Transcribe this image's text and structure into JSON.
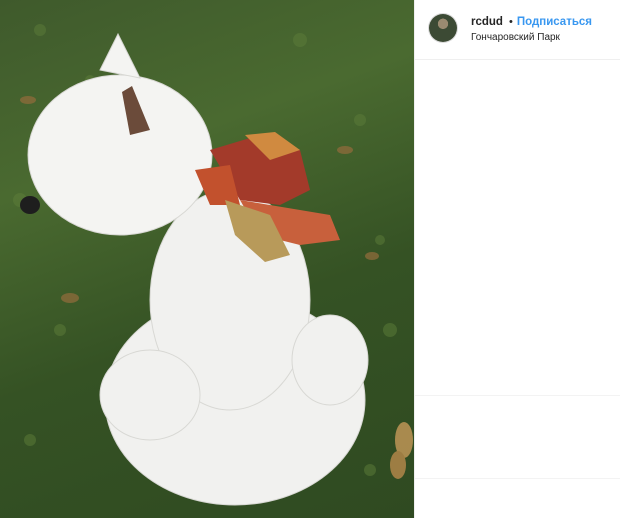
{
  "post": {
    "username": "rcdud",
    "separator": "•",
    "follow_label": "Подписаться",
    "location": "Гончаровский Парк",
    "photo_subject": "white-west-highland-terrier-with-autumn-leaves"
  },
  "colors": {
    "follow": "#3897f0",
    "text": "#262626",
    "divider": "#efefef"
  }
}
